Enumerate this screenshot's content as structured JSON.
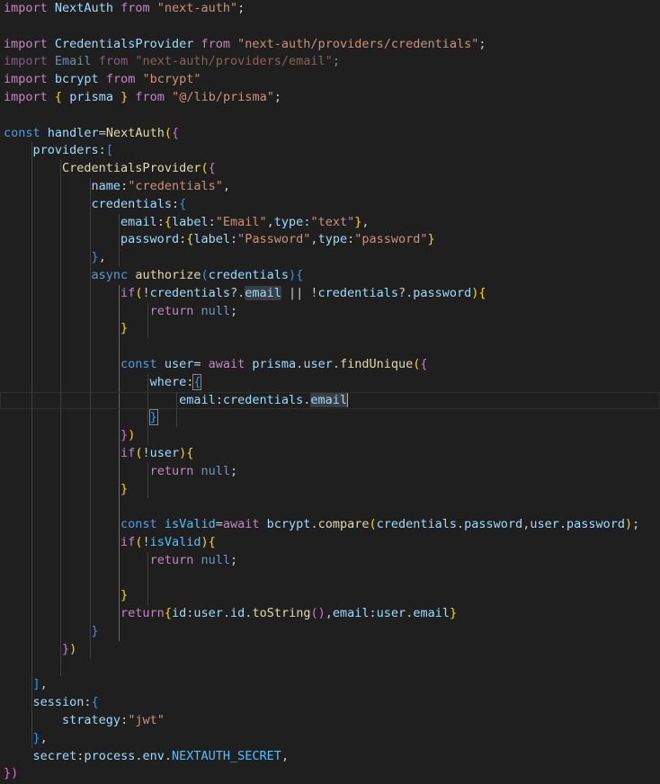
{
  "colors": {
    "background": "#1f1f1f",
    "keyword": "#c586c0",
    "storage": "#569cd6",
    "variable": "#9cdcfe",
    "function": "#dcdcaa",
    "string": "#ce9178",
    "plain": "#cccccc",
    "bracket1": "#ffd700",
    "bracket2": "#da70d6",
    "bracket3": "#179fff",
    "constant": "#4fc1ff"
  },
  "lines": [
    [
      [
        "import",
        "keyword"
      ],
      [
        " ",
        "plain"
      ],
      [
        "NextAuth",
        "variable"
      ],
      [
        " ",
        "plain"
      ],
      [
        "from",
        "keyword"
      ],
      [
        " ",
        "plain"
      ],
      [
        "\"next-auth\"",
        "string"
      ],
      [
        ";",
        "plain"
      ]
    ],
    [],
    [
      [
        "import",
        "keyword"
      ],
      [
        " ",
        "plain"
      ],
      [
        "CredentialsProvider",
        "variable"
      ],
      [
        " ",
        "plain"
      ],
      [
        "from",
        "keyword"
      ],
      [
        " ",
        "plain"
      ],
      [
        "\"next-auth/providers/credentials\"",
        "string"
      ],
      [
        ";",
        "plain"
      ]
    ],
    [
      [
        "import",
        "keyword"
      ],
      [
        " ",
        "plain"
      ],
      [
        "Email",
        "variable"
      ],
      [
        " ",
        "plain"
      ],
      [
        "from",
        "keyword"
      ],
      [
        " ",
        "plain"
      ],
      [
        "\"next-auth/providers/email\"",
        "string"
      ],
      [
        ";",
        "plain"
      ]
    ],
    [
      [
        "import",
        "keyword"
      ],
      [
        " ",
        "plain"
      ],
      [
        "bcrypt",
        "variable"
      ],
      [
        " ",
        "plain"
      ],
      [
        "from",
        "keyword"
      ],
      [
        " ",
        "plain"
      ],
      [
        "\"bcrypt\"",
        "string"
      ]
    ],
    [
      [
        "import",
        "keyword"
      ],
      [
        " ",
        "plain"
      ],
      [
        "{",
        "bracket1"
      ],
      [
        " ",
        "plain"
      ],
      [
        "prisma",
        "variable"
      ],
      [
        " ",
        "plain"
      ],
      [
        "}",
        "bracket1"
      ],
      [
        " ",
        "plain"
      ],
      [
        "from",
        "keyword"
      ],
      [
        " ",
        "plain"
      ],
      [
        "\"@/lib/prisma\"",
        "string"
      ],
      [
        ";",
        "plain"
      ]
    ],
    [],
    [
      [
        "const",
        "storage"
      ],
      [
        " ",
        "plain"
      ],
      [
        "handler",
        "variable"
      ],
      [
        "=",
        "plain"
      ],
      [
        "NextAuth",
        "function"
      ],
      [
        "(",
        "bracket1"
      ],
      [
        "{",
        "bracket2"
      ]
    ],
    [
      [
        "    ",
        "plain"
      ],
      [
        "providers",
        "variable"
      ],
      [
        ":",
        "plain"
      ],
      [
        "[",
        "bracket3"
      ]
    ],
    [
      [
        "        ",
        "plain"
      ],
      [
        "CredentialsProvider",
        "function"
      ],
      [
        "(",
        "bracket1"
      ],
      [
        "{",
        "bracket2"
      ]
    ],
    [
      [
        "            ",
        "plain"
      ],
      [
        "name",
        "variable"
      ],
      [
        ":",
        "plain"
      ],
      [
        "\"credentials\"",
        "string"
      ],
      [
        ",",
        "plain"
      ]
    ],
    [
      [
        "            ",
        "plain"
      ],
      [
        "credentials",
        "variable"
      ],
      [
        ":",
        "plain"
      ],
      [
        "{",
        "bracket3"
      ]
    ],
    [
      [
        "                ",
        "plain"
      ],
      [
        "email",
        "variable"
      ],
      [
        ":",
        "plain"
      ],
      [
        "{",
        "bracket1"
      ],
      [
        "label",
        "variable"
      ],
      [
        ":",
        "plain"
      ],
      [
        "\"Email\"",
        "string"
      ],
      [
        ",",
        "plain"
      ],
      [
        "type",
        "variable"
      ],
      [
        ":",
        "plain"
      ],
      [
        "\"text\"",
        "string"
      ],
      [
        "}",
        "bracket1"
      ],
      [
        ",",
        "plain"
      ]
    ],
    [
      [
        "                ",
        "plain"
      ],
      [
        "password",
        "variable"
      ],
      [
        ":",
        "plain"
      ],
      [
        "{",
        "bracket1"
      ],
      [
        "label",
        "variable"
      ],
      [
        ":",
        "plain"
      ],
      [
        "\"Password\"",
        "string"
      ],
      [
        ",",
        "plain"
      ],
      [
        "type",
        "variable"
      ],
      [
        ":",
        "plain"
      ],
      [
        "\"password\"",
        "string"
      ],
      [
        "}",
        "bracket1"
      ]
    ],
    [
      [
        "            ",
        "plain"
      ],
      [
        "}",
        "bracket3"
      ],
      [
        ",",
        "plain"
      ]
    ],
    [
      [
        "            ",
        "plain"
      ],
      [
        "async",
        "storage"
      ],
      [
        " ",
        "plain"
      ],
      [
        "authorize",
        "function"
      ],
      [
        "(",
        "bracket3"
      ],
      [
        "credentials",
        "variable"
      ],
      [
        ")",
        "bracket3"
      ],
      [
        "{",
        "bracket3"
      ]
    ],
    [
      [
        "                ",
        "plain"
      ],
      [
        "if",
        "keyword"
      ],
      [
        "(",
        "bracket1"
      ],
      [
        "!",
        "plain"
      ],
      [
        "credentials",
        "variable"
      ],
      [
        "?.",
        "plain"
      ],
      [
        "email",
        "variable-hl"
      ],
      [
        " || !",
        "plain"
      ],
      [
        "credentials",
        "variable"
      ],
      [
        "?.",
        "plain"
      ],
      [
        "password",
        "variable"
      ],
      [
        ")",
        "bracket1"
      ],
      [
        "{",
        "bracket1"
      ]
    ],
    [
      [
        "                    ",
        "plain"
      ],
      [
        "return",
        "keyword"
      ],
      [
        " ",
        "plain"
      ],
      [
        "null",
        "storage"
      ],
      [
        ";",
        "plain"
      ]
    ],
    [
      [
        "                ",
        "plain"
      ],
      [
        "}",
        "bracket1"
      ]
    ],
    [],
    [
      [
        "                ",
        "plain"
      ],
      [
        "const",
        "storage"
      ],
      [
        " ",
        "plain"
      ],
      [
        "user",
        "variable"
      ],
      [
        "= ",
        "plain"
      ],
      [
        "await",
        "keyword"
      ],
      [
        " ",
        "plain"
      ],
      [
        "prisma",
        "variable"
      ],
      [
        ".",
        "plain"
      ],
      [
        "user",
        "variable"
      ],
      [
        ".",
        "plain"
      ],
      [
        "findUnique",
        "function"
      ],
      [
        "(",
        "bracket1"
      ],
      [
        "{",
        "bracket2"
      ]
    ],
    [
      [
        "                    ",
        "plain"
      ],
      [
        "where",
        "variable"
      ],
      [
        ":",
        "plain"
      ],
      [
        "{",
        "bracket3-match"
      ]
    ],
    [
      [
        "                        ",
        "plain"
      ],
      [
        "email",
        "variable"
      ],
      [
        ":",
        "plain"
      ],
      [
        "credentials",
        "variable"
      ],
      [
        ".",
        "plain"
      ],
      [
        "email",
        "variable-hl"
      ],
      [
        "",
        "cursor"
      ]
    ],
    [
      [
        "                    ",
        "plain"
      ],
      [
        "}",
        "bracket3-match"
      ]
    ],
    [
      [
        "                ",
        "plain"
      ],
      [
        "}",
        "bracket2"
      ],
      [
        ")",
        "bracket1"
      ]
    ],
    [
      [
        "                ",
        "plain"
      ],
      [
        "if",
        "keyword"
      ],
      [
        "(",
        "bracket1"
      ],
      [
        "!",
        "plain"
      ],
      [
        "user",
        "variable"
      ],
      [
        ")",
        "bracket1"
      ],
      [
        "{",
        "bracket1"
      ]
    ],
    [
      [
        "                    ",
        "plain"
      ],
      [
        "return",
        "keyword"
      ],
      [
        " ",
        "plain"
      ],
      [
        "null",
        "storage"
      ],
      [
        ";",
        "plain"
      ]
    ],
    [
      [
        "                ",
        "plain"
      ],
      [
        "}",
        "bracket1"
      ]
    ],
    [],
    [
      [
        "                ",
        "plain"
      ],
      [
        "const",
        "storage"
      ],
      [
        " ",
        "plain"
      ],
      [
        "isValid",
        "constant"
      ],
      [
        "=",
        "plain"
      ],
      [
        "await",
        "keyword"
      ],
      [
        " ",
        "plain"
      ],
      [
        "bcrypt",
        "variable"
      ],
      [
        ".",
        "plain"
      ],
      [
        "compare",
        "function"
      ],
      [
        "(",
        "bracket1"
      ],
      [
        "credentials",
        "variable"
      ],
      [
        ".",
        "plain"
      ],
      [
        "password",
        "variable"
      ],
      [
        ",",
        "plain"
      ],
      [
        "user",
        "variable"
      ],
      [
        ".",
        "plain"
      ],
      [
        "password",
        "variable"
      ],
      [
        ")",
        "bracket1"
      ],
      [
        ";",
        "plain"
      ]
    ],
    [
      [
        "                ",
        "plain"
      ],
      [
        "if",
        "keyword"
      ],
      [
        "(",
        "bracket1"
      ],
      [
        "!",
        "plain"
      ],
      [
        "isValid",
        "constant"
      ],
      [
        ")",
        "bracket1"
      ],
      [
        "{",
        "bracket1"
      ]
    ],
    [
      [
        "                    ",
        "plain"
      ],
      [
        "return",
        "keyword"
      ],
      [
        " ",
        "plain"
      ],
      [
        "null",
        "storage"
      ],
      [
        ";",
        "plain"
      ]
    ],
    [],
    [
      [
        "                ",
        "plain"
      ],
      [
        "}",
        "bracket1"
      ]
    ],
    [
      [
        "                ",
        "plain"
      ],
      [
        "return",
        "keyword"
      ],
      [
        "{",
        "bracket1"
      ],
      [
        "id",
        "variable"
      ],
      [
        ":",
        "plain"
      ],
      [
        "user",
        "variable"
      ],
      [
        ".",
        "plain"
      ],
      [
        "id",
        "variable"
      ],
      [
        ".",
        "plain"
      ],
      [
        "toString",
        "function"
      ],
      [
        "(",
        "bracket2"
      ],
      [
        ")",
        "bracket2"
      ],
      [
        ",",
        "plain"
      ],
      [
        "email",
        "variable"
      ],
      [
        ":",
        "plain"
      ],
      [
        "user",
        "variable"
      ],
      [
        ".",
        "plain"
      ],
      [
        "email",
        "variable"
      ],
      [
        "}",
        "bracket1"
      ]
    ],
    [
      [
        "            ",
        "plain"
      ],
      [
        "}",
        "bracket3"
      ]
    ],
    [
      [
        "        ",
        "plain"
      ],
      [
        "}",
        "bracket2"
      ],
      [
        ")",
        "bracket1"
      ]
    ],
    [],
    [
      [
        "    ",
        "plain"
      ],
      [
        "]",
        "bracket3"
      ],
      [
        ",",
        "plain"
      ]
    ],
    [
      [
        "    ",
        "plain"
      ],
      [
        "session",
        "variable"
      ],
      [
        ":",
        "plain"
      ],
      [
        "{",
        "bracket3"
      ]
    ],
    [
      [
        "        ",
        "plain"
      ],
      [
        "strategy",
        "variable"
      ],
      [
        ":",
        "plain"
      ],
      [
        "\"jwt\"",
        "string"
      ]
    ],
    [
      [
        "    ",
        "plain"
      ],
      [
        "}",
        "bracket3"
      ],
      [
        ",",
        "plain"
      ]
    ],
    [
      [
        "    ",
        "plain"
      ],
      [
        "secret",
        "variable"
      ],
      [
        ":",
        "plain"
      ],
      [
        "process",
        "variable"
      ],
      [
        ".",
        "plain"
      ],
      [
        "env",
        "variable"
      ],
      [
        ".",
        "plain"
      ],
      [
        "NEXTAUTH_SECRET",
        "constant"
      ],
      [
        ",",
        "plain"
      ]
    ],
    [
      [
        "})",
        "bracket2-close"
      ]
    ]
  ]
}
